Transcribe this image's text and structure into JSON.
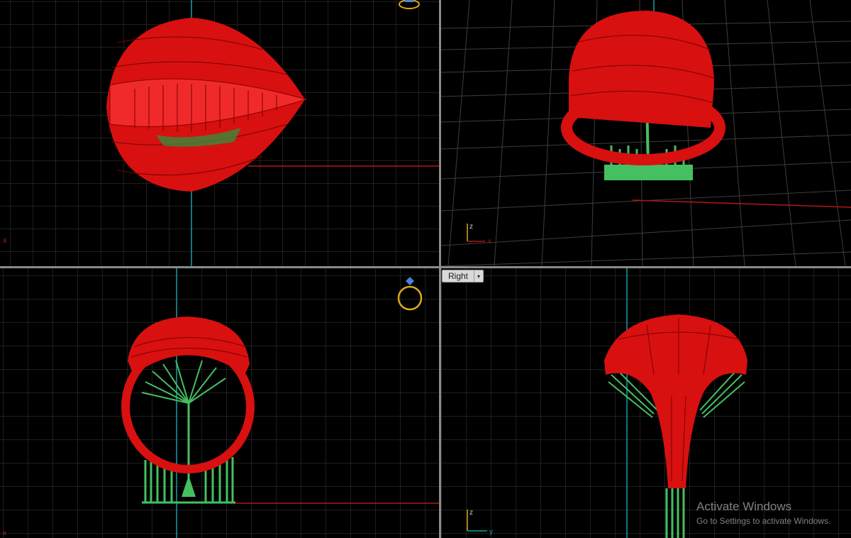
{
  "viewports": {
    "top": {
      "name": ""
    },
    "perspective": {
      "name": ""
    },
    "front": {
      "name": ""
    },
    "right": {
      "name": "Right",
      "dropdown_glyph": "▾"
    }
  },
  "axes": {
    "x": "x",
    "y": "y",
    "z": "z"
  },
  "icons": {
    "ring_widget": "ring-icon"
  },
  "watermark": {
    "title": "Activate Windows",
    "subtitle": "Go to Settings to activate Windows."
  },
  "colors": {
    "background": "#000000",
    "grid_minor": "#2e2e2e",
    "grid_major": "#4a4a4a",
    "x_axis": "#b01818",
    "y_axis": "#12a0a8",
    "model": "#e01010",
    "supports": "#45c060",
    "ring_icon": "#d8a818"
  }
}
